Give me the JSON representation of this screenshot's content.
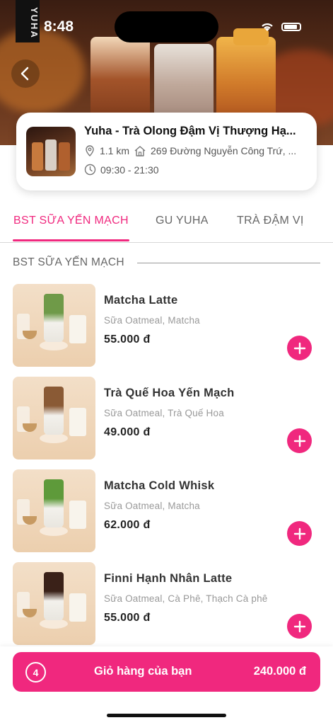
{
  "status_bar": {
    "time": "8:48",
    "brand": "YUHA"
  },
  "store": {
    "name": "Yuha - Trà Olong Đậm Vị Thượng Hạ...",
    "distance": "1.1 km",
    "address": "269 Đường Nguyễn Công Trứ, ...",
    "hours": "09:30 - 21:30"
  },
  "tabs": [
    {
      "label": "BST SỮA YẾN MẠCH",
      "active": true
    },
    {
      "label": "GU YUHA",
      "active": false
    },
    {
      "label": "TRÀ ĐẬM VỊ",
      "active": false
    }
  ],
  "section_title": "BST SỮA YẾN MẠCH",
  "products": [
    {
      "name": "Matcha Latte",
      "description": " Sữa Oatmeal, Matcha",
      "price": "55.000 đ",
      "drink_color": "#6f9a48"
    },
    {
      "name": "Trà Quế Hoa Yến Mạch",
      "description": "Sữa Oatmeal, Trà Quế Hoa",
      "price": "49.000 đ",
      "drink_color": "#8a5a35"
    },
    {
      "name": "Matcha Cold Whisk",
      "description": "Sữa Oatmeal, Matcha",
      "price": "62.000 đ",
      "drink_color": "#5e9a3a"
    },
    {
      "name": "Finni Hạnh Nhân Latte",
      "description": "Sữa Oatmeal, Cà Phê, Thạch Cà phê",
      "price": "55.000 đ",
      "drink_color": "#3a2118"
    }
  ],
  "cart": {
    "count": "4",
    "label": "Giỏ hàng của bạn",
    "total": "240.000 đ"
  },
  "colors": {
    "accent": "#f0287e"
  },
  "icons": [
    "back-arrow-icon",
    "location-pin-icon",
    "home-icon",
    "clock-icon",
    "plus-icon",
    "wifi-icon",
    "battery-icon"
  ]
}
